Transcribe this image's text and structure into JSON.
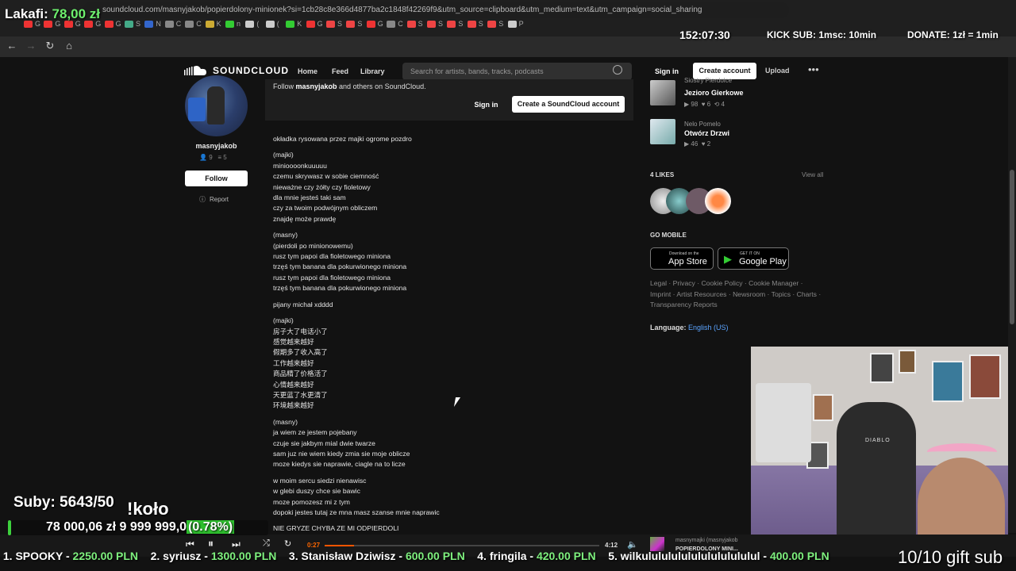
{
  "browser": {
    "url": "soundcloud.com/masnyjakob/popierdolony-minionek?si=1cb28c8e366d4877ba2c1848f42269f9&utm_source=clipboard&utm_medium=text&utm_campaign=social_sharing",
    "tabs": [
      "G",
      "G",
      "G",
      "G",
      "G",
      "S",
      "N",
      "C",
      "C",
      "K",
      "n",
      "(",
      "(",
      "K",
      "G",
      "S",
      "S",
      "G",
      "C",
      "S",
      "S",
      "S",
      "S",
      "S",
      "P"
    ]
  },
  "overlay": {
    "lakafi_label": "Lakafi:",
    "lakafi_value": "78,00 zł",
    "timer": "152:07:30",
    "kick_sub": "KICK SUB: 1msc: 10min",
    "donate": "DONATE: 1zł = 1min",
    "subs": "Suby: 5643/50",
    "kolo": "!koło",
    "goal_left": "78 000,06 zł",
    "goal_right": "9 999 999,0",
    "goal_pct": "(0.78%)",
    "goal_fraction": 0.0078,
    "gift_sub": "10/10 gift sub",
    "ticker": [
      {
        "name": "1. SPOOKY - ",
        "amount": "2250.00 PLN"
      },
      {
        "name": "2. syriusz - ",
        "amount": "1300.00 PLN"
      },
      {
        "name": "3. Stanisław Dziwisz - ",
        "amount": "600.00 PLN"
      },
      {
        "name": "4. fringila - ",
        "amount": "420.00 PLN"
      },
      {
        "name": "5. wilkulululululululululululul - ",
        "amount": "400.00 PLN"
      }
    ]
  },
  "header": {
    "logo": "SOUNDCLOUD",
    "nav_home": "Home",
    "nav_feed": "Feed",
    "nav_library": "Library",
    "search_placeholder": "Search for artists, bands, tracks, podcasts",
    "signin": "Sign in",
    "create_account": "Create account",
    "upload": "Upload",
    "more": "•••"
  },
  "artist": {
    "name": "masnyjakob",
    "followers": "9",
    "tracks": "5",
    "follow": "Follow",
    "report": "Report"
  },
  "banner": {
    "text_pre": "Follow ",
    "text_bold": "masnyjakob",
    "text_post": " and others on SoundCloud.",
    "signin": "Sign in",
    "create": "Create a SoundCloud account"
  },
  "description": [
    [
      "okładka rysowana przez majki ogrome pozdro"
    ],
    [
      "(majki)",
      "minioooonkuuuuu",
      "czemu skrywasz w sobie ciemność",
      "nieważne czy żółty czy fioletowy",
      "dla mnie jesteś taki sam",
      "czy za twoim podwójnym obliczem",
      "znajdę może prawdę"
    ],
    [
      "(masny)",
      "(pierdoli po minionowemu)",
      "rusz tym papoi dla fioletowego miniona",
      "trzęś tym banana dla pokurwionego miniona",
      "rusz tym papoi dla fioletowego miniona",
      "trzęś tym banana dla pokurwionego miniona"
    ],
    [
      "pijany michał xdddd"
    ],
    [
      "(majki)",
      "房子大了电话小了",
      "感觉越来越好",
      "假期多了收入高了",
      "工作越来越好",
      "商品精了价格活了",
      "心情越来越好",
      "天更蓝了水更清了",
      "环境越来越好"
    ],
    [
      "(masny)",
      "ja wiem ze jestem pojebany",
      "czuje sie jakbym mial dwie twarze",
      "sam juz nie wiem kiedy zmia sie moje oblicze",
      "moze kiedys sie naprawie, ciagle na to licze"
    ],
    [
      "w moim sercu siedzi nienawisc",
      "w glebi duszy chce sie bawic",
      "moze pomozesz mi z tym",
      "dopoki jestes tutaj ze mna masz szanse mnie naprawic"
    ],
    [
      "NIE GRYZE CHYBA ZE MI ODPIERDOLI"
    ]
  ],
  "related": [
    {
      "artist": "Siostry Pierdolce",
      "title": "Jezioro Gierkowe",
      "plays": "98",
      "likes": "6",
      "reposts": "4"
    },
    {
      "artist": "Nelo Pomelo",
      "title": "Otwórz Drzwi",
      "plays": "46",
      "likes": "2",
      "reposts": ""
    }
  ],
  "likes": {
    "title": "4 LIKES",
    "view_all": "View all"
  },
  "mobile": {
    "title": "GO MOBILE",
    "appstore_small": "Download on the",
    "appstore_big": "App Store",
    "gplay_small": "GET IT ON",
    "gplay_big": "Google Play"
  },
  "footer": {
    "links": "Legal · Privacy · Cookie Policy · Cookie Manager · Imprint · Artist Resources · Newsroom · Topics · Charts · Transparency Reports",
    "language_label": "Language: ",
    "language_value": "English (US)"
  },
  "player": {
    "current": "0:27",
    "total": "4:12",
    "progress": 0.107,
    "np_artist": "masnymajki (masnyjakob",
    "np_title": "POPIERDOLONY MINI..."
  },
  "webcam": {
    "chair_logo": "DIABLO"
  },
  "colors": {
    "accent": "#ff5500",
    "overlay_green": "#6ef06e"
  }
}
